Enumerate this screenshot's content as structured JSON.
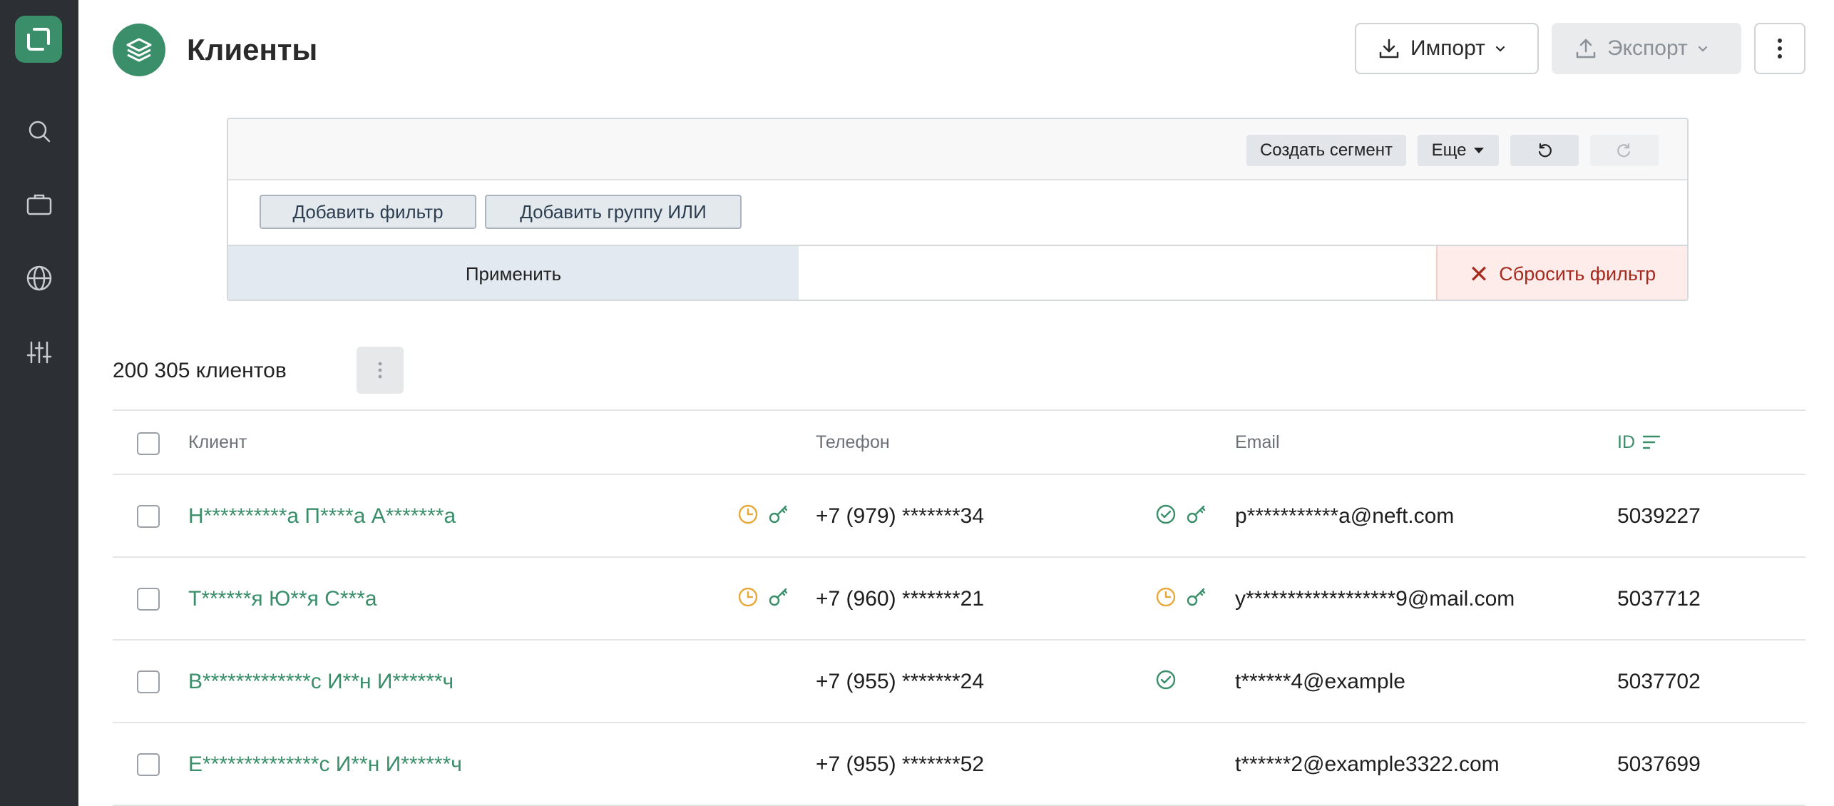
{
  "app": {
    "title": "Клиенты",
    "brand_color": "#3a8f6a"
  },
  "sidebar": {
    "items": [
      {
        "name": "logo",
        "icon": "app-logo-icon"
      },
      {
        "name": "search",
        "icon": "search-icon"
      },
      {
        "name": "briefcase",
        "icon": "briefcase-icon"
      },
      {
        "name": "globe",
        "icon": "globe-icon"
      },
      {
        "name": "settings",
        "icon": "sliders-icon"
      }
    ]
  },
  "header": {
    "import_label": "Импорт",
    "export_label": "Экспорт"
  },
  "filter": {
    "create_segment": "Создать сегмент",
    "more": "Еще",
    "add_filter": "Добавить фильтр",
    "add_or_group": "Добавить группу ИЛИ",
    "apply": "Применить",
    "reset": "Сбросить фильтр"
  },
  "summary": {
    "count_text": "200 305 клиентов"
  },
  "table": {
    "columns": {
      "client": "Клиент",
      "phone": "Телефон",
      "email": "Email",
      "id": "ID"
    },
    "rows": [
      {
        "name": "Н**********а П****а А*******а",
        "phone": "+7 (979) *******34",
        "email": "p***********a@neft.com",
        "id": "5039227",
        "name_icons": [
          "clock-icon",
          "key-icon"
        ],
        "phone_icons": [
          "check-circle-icon",
          "key-icon"
        ]
      },
      {
        "name": "Т******я Ю**я С***а",
        "phone": "+7 (960) *******21",
        "email": "y******************9@mail.com",
        "id": "5037712",
        "name_icons": [
          "clock-icon",
          "key-icon"
        ],
        "phone_icons": [
          "clock-icon",
          "key-icon"
        ]
      },
      {
        "name": "В*************с И**н И******ч",
        "phone": "+7 (955) *******24",
        "email": "t******4@example",
        "id": "5037702",
        "name_icons": [],
        "phone_icons": [
          "check-circle-icon"
        ]
      },
      {
        "name": "Е**************с И**н И******ч",
        "phone": "+7 (955) *******52",
        "email": "t******2@example3322.com",
        "id": "5037699",
        "name_icons": [],
        "phone_icons": []
      }
    ]
  }
}
